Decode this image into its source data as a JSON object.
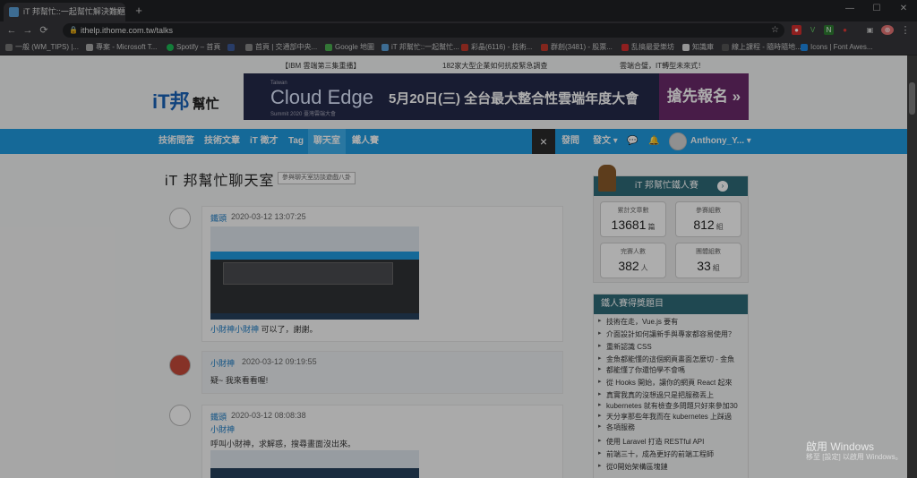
{
  "browser": {
    "tab_title": "iT 邦幫忙::一起幫忙解決難題，拯",
    "tab_close": "×",
    "newtab": "+",
    "window_controls": [
      "—",
      "☐",
      "✕"
    ],
    "nav": [
      "←",
      "→",
      "⟳"
    ],
    "url": "ithelp.ithome.com.tw/talks",
    "lock": "🔒",
    "star": "☆",
    "menu": "⋮",
    "extensions": [
      "●",
      "V",
      "N",
      "●",
      "▣",
      "⊕"
    ],
    "bookmarks": [
      {
        "label": "一般 (WM_TIPS) |...",
        "color": "#777"
      },
      {
        "label": "專案 - Microsoft T...",
        "color": "#aaa"
      },
      {
        "label": "Spotify – 首頁",
        "color": "#1db954"
      },
      {
        "label": "",
        "color": "#3b5998"
      },
      {
        "label": "首頁 | 交通部中央...",
        "color": "#888"
      },
      {
        "label": "Google 地圖",
        "color": "#4caf50"
      },
      {
        "label": "iT 邦幫忙::一起幫忙...",
        "color": "#5aa0d8"
      },
      {
        "label": "彩晶(6116) - 技術...",
        "color": "#c0392b"
      },
      {
        "label": "群創(3481) - 股票...",
        "color": "#c0392b"
      },
      {
        "label": "乱搞最愛樂坊",
        "color": "#d32f2f"
      },
      {
        "label": "知識庫",
        "color": "#ddd"
      },
      {
        "label": "線上課程 - 隨時隨地...",
        "color": "#555"
      },
      {
        "label": "Icons | Font Awes...",
        "color": "#1e88e5"
      }
    ]
  },
  "site": {
    "top_notes": [
      "【IBM 雲端第三集重播】",
      "182家大型企業如何抗疫緊急調查",
      "雲端合璧，IT轉型未來式！"
    ],
    "logo": "iT邦",
    "logo_sub": "幫忙",
    "banner": {
      "small": "Taiwan",
      "title": "Cloud Edge",
      "sub": "Summit 2020 臺灣雲端大會",
      "date": "5月20日(三) 全台最大整合性雲端年度大會",
      "cta": "搶先報名 »"
    },
    "nav": [
      "技術問答",
      "技術文章",
      "iT 徵才",
      "Tag",
      "聊天室",
      "鐵人賽"
    ],
    "nav_right": [
      "發問",
      "發文 ▾",
      "Anthony_Y... ▾"
    ],
    "close": "×",
    "page_title": "iT 邦幫忙聊天室",
    "page_tag": "參與聊天室訪談遊戲八卦",
    "messages": [
      {
        "name": "鐵頭",
        "time": "2020-03-12 13:07:25",
        "text_link": "小財神小財神",
        "text": " 可以了，謝謝。"
      },
      {
        "name": "小財神",
        "time": "2020-03-12 09:19:55",
        "text": "疑~ 我來看看喔!"
      },
      {
        "name": "鐵頭",
        "time": "2020-03-12 08:08:38",
        "text_link": "小財神",
        "text": "呼叫小財神，求解惑，搜尋畫面沒出來。"
      }
    ],
    "widget1": {
      "title": "iT 邦幫忙鐵人賽",
      "stats": [
        {
          "label": "累計文章數",
          "value": "13681",
          "unit": "篇"
        },
        {
          "label": "參賽組數",
          "value": "812",
          "unit": "組"
        },
        {
          "label": "完賽人數",
          "value": "382",
          "unit": "人"
        },
        {
          "label": "團體組數",
          "value": "33",
          "unit": "組"
        }
      ]
    },
    "widget2": {
      "title": "鐵人賽得獎題目",
      "topics": [
        "技術在走，Vue.js 要有",
        "介面設計如何讓新手與專家都容易使用？",
        "重新認識 CSS",
        "金魚都能懂的這個網頁畫面怎麼切 - 金魚",
        "都能懂了你還怕學不會嗎",
        "從 Hooks 開始，讓你的網頁 React 起來",
        "真實我真的沒想過只是把服務丟上",
        "kubernetes 就有檢查多問題只好來參加30",
        "天分享那些年我而在 kubernetes 上踩過",
        "各項服務",
        "使用 Laravel 打造 RESTful API",
        "前端三十，成為更好的前端工程師",
        "從0開始架構區塊鏈"
      ]
    }
  },
  "windows_activation": {
    "title": "啟用 Windows",
    "sub": "移至 [設定] 以啟用 Windows。"
  }
}
